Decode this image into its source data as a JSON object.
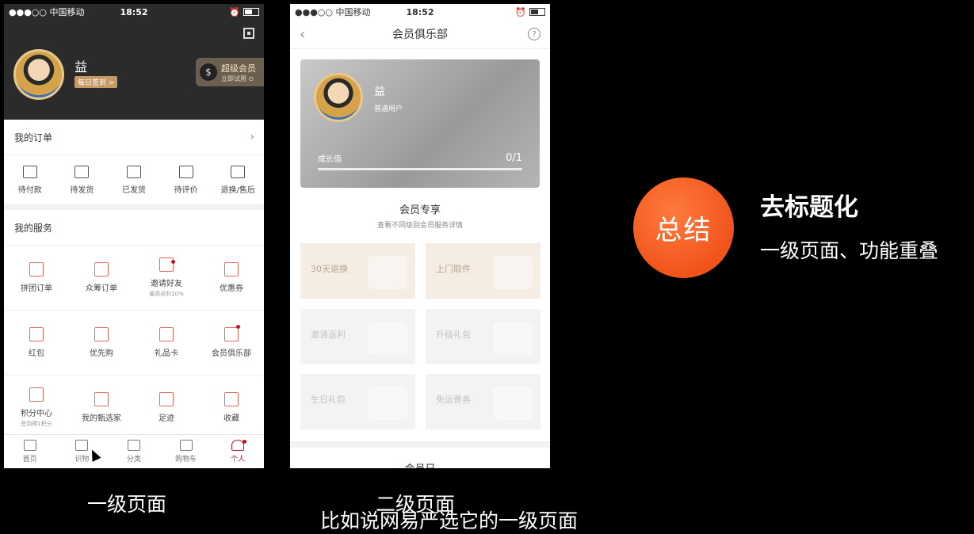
{
  "colors": {
    "accent": "#c0152f",
    "summary": "#f0541b",
    "dark_header": "#2b2b2b"
  },
  "status_bar_left": {
    "carrier": "●●●○○ 中国移动",
    "time": "18:52"
  },
  "status_bar_right": {
    "carrier": "●●●○○ 中国移动",
    "time": "18:52"
  },
  "profile": {
    "name": "益",
    "checkin": "每日签到 >",
    "vip_title": "超级会员",
    "vip_sub": "立即试用 ⊙"
  },
  "orders": {
    "title": "我的订单",
    "items": [
      {
        "label": "待付款",
        "icon": "wallet-icon"
      },
      {
        "label": "待发货",
        "icon": "box-icon"
      },
      {
        "label": "已发货",
        "icon": "truck-icon"
      },
      {
        "label": "待评价",
        "icon": "comment-icon"
      },
      {
        "label": "退换/售后",
        "icon": "refund-icon"
      }
    ]
  },
  "services": {
    "title": "我的服务",
    "items": [
      {
        "label": "拼团订单",
        "sub": "",
        "icon": "group-order-icon"
      },
      {
        "label": "众筹订单",
        "sub": "",
        "icon": "crowdfund-icon"
      },
      {
        "label": "邀请好友",
        "sub": "最高返利10%",
        "icon": "invite-icon"
      },
      {
        "label": "优惠券",
        "sub": "",
        "icon": "coupon-icon"
      },
      {
        "label": "红包",
        "sub": "",
        "icon": "red-packet-icon"
      },
      {
        "label": "优先购",
        "sub": "",
        "icon": "priority-buy-icon"
      },
      {
        "label": "礼品卡",
        "sub": "",
        "icon": "gift-card-icon"
      },
      {
        "label": "会员俱乐部",
        "sub": "",
        "icon": "member-club-icon"
      },
      {
        "label": "积分中心",
        "sub": "签到得1积分",
        "icon": "points-icon"
      },
      {
        "label": "我的甄选家",
        "sub": "",
        "icon": "diamond-icon"
      },
      {
        "label": "足迹",
        "sub": "",
        "icon": "footprint-icon"
      },
      {
        "label": "收藏",
        "sub": "",
        "icon": "star-icon"
      }
    ]
  },
  "tabbar": [
    {
      "label": "首页",
      "icon": "home-icon"
    },
    {
      "label": "识物",
      "icon": "discover-icon"
    },
    {
      "label": "分类",
      "icon": "category-icon"
    },
    {
      "label": "购物车",
      "icon": "cart-icon"
    },
    {
      "label": "个人",
      "icon": "profile-icon"
    }
  ],
  "club": {
    "title": "会员俱乐部",
    "name": "益",
    "level": "普通用户",
    "growth_label": "成长值",
    "growth_value": "0/1",
    "exclusive_title": "会员专享",
    "exclusive_sub": "查看不同级别会员服务详情",
    "perks": [
      "30天退换",
      "上门取件",
      "邀请返利",
      "升级礼包",
      "生日礼包",
      "免运费券"
    ],
    "member_day": "会员日"
  },
  "summary": {
    "circle": "总结",
    "title": "去标题化",
    "sub": "一级页面、功能重叠"
  },
  "captions": {
    "left": "一级页面",
    "right": "二级页面",
    "bottom": "比如说网易严选它的一级页面"
  }
}
